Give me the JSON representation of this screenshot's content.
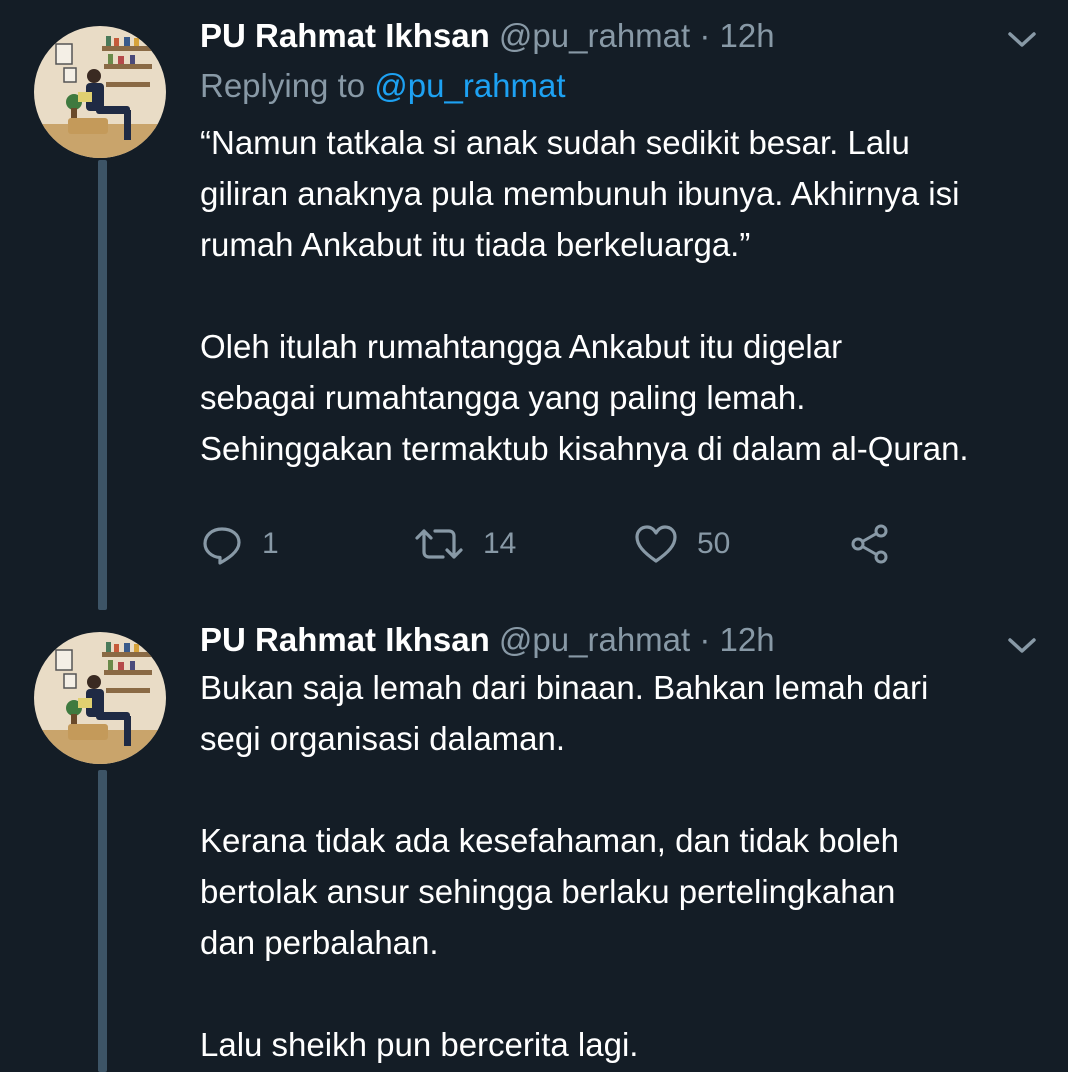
{
  "tweets": [
    {
      "author_name": "PU Rahmat Ikhsan",
      "handle": "@pu_rahmat",
      "separator": "·",
      "time": "12h",
      "replying_prefix": "Replying to",
      "replying_to": "@pu_rahmat",
      "paragraphs": [
        [
          "“Namun tatkala si anak sudah sedikit besar. Lalu",
          "giliran anaknya pula membunuh ibunya. Akhirnya isi",
          "rumah Ankabut itu tiada berkeluarga.”"
        ],
        [
          "Oleh itulah rumahtangga Ankabut itu digelar",
          "sebagai rumahtangga yang paling lemah.",
          "Sehinggakan termaktub kisahnya di dalam al-Quran."
        ]
      ],
      "actions": {
        "reply_count": "1",
        "retweet_count": "14",
        "like_count": "50"
      }
    },
    {
      "author_name": "PU Rahmat Ikhsan",
      "handle": "@pu_rahmat",
      "separator": "·",
      "time": "12h",
      "paragraphs": [
        [
          "Bukan saja lemah dari binaan. Bahkan lemah dari",
          "segi organisasi dalaman."
        ],
        [
          "Kerana tidak ada kesefahaman, dan tidak boleh",
          "bertolak ansur sehingga berlaku pertelingkahan",
          "dan perbalahan."
        ],
        [
          "Lalu sheikh pun bercerita lagi."
        ]
      ]
    }
  ],
  "colors": {
    "background": "#141d26",
    "text_primary": "#ffffff",
    "text_secondary": "#8899a6",
    "link": "#1da1f2",
    "thread_line": "#3d5466"
  },
  "icons": [
    "chevron-down-icon",
    "reply-icon",
    "retweet-icon",
    "like-icon",
    "share-icon"
  ]
}
